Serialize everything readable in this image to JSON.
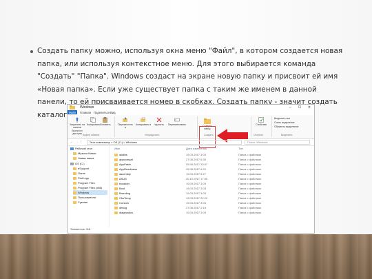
{
  "slide": {
    "text": "Создать папку можно, используя окна меню \"Файл\", в котором создается новая папка, или используя контекстное меню. Для этого выбирается команда \"Создать\" \"Папка\". Windows создаст на экране новую папку и присвоит ей имя «Новая папка». Если уже существует папка с таким же именем в данной панели, то ей присваивается номер в скобках. Создать папку - значит создать каталог."
  },
  "window": {
    "title": "Windows",
    "tabs": [
      "Файл",
      "Главная",
      "Поделиться",
      "Вид"
    ],
    "ribbon": {
      "pin": "Закрепить на панели быстрого доступа",
      "copy": "Копировать",
      "paste": "Вставить",
      "move": "Переместить в",
      "copy_to": "Копировать в",
      "delete": "Удалить",
      "rename": "Переименовать",
      "new_folder": "Создать папку",
      "properties": "Свойства",
      "select_all": "Выделить все",
      "select_none": "Снять выделение",
      "invert": "Обратить выделение",
      "groups": [
        "Буфер обмена",
        "Упорядочить",
        "Создать",
        "Открыть",
        "Выделить"
      ]
    },
    "address": "Этот компьютер > OS (C:) > Windows",
    "search_placeholder": "Поиск: Windows",
    "columns": [
      "Имя",
      "Дата изменения",
      "Тип"
    ],
    "nav": [
      "Рабочий стол",
      "Музыка Мамы",
      "Новая папка",
      "OS (C:)",
      "eSupport",
      "Game",
      "PerfLogs",
      "Program Files",
      "Program Files (x86)",
      "Windows",
      "Пользователи",
      "Сумлан"
    ],
    "files": [
      {
        "name": "addins",
        "date": "19.03.2017 3:03",
        "type": "Папка с файлами"
      },
      {
        "name": "appcompat",
        "date": "27.08.2017 6:30",
        "type": "Папка с файлами"
      },
      {
        "name": "AppPatch",
        "date": "25.08.2017 20:07",
        "type": "Папка с файлами"
      },
      {
        "name": "AppReadiness",
        "date": "25.08.2017 8:20",
        "type": "Папка с файлами"
      },
      {
        "name": "assembly",
        "date": "19.03.2017 6:27",
        "type": "Папка с файлами"
      },
      {
        "name": "ASUS",
        "date": "30.10.2017 17:55",
        "type": "Папка с файлами"
      },
      {
        "name": "bcastdvr",
        "date": "19.03.2017 3:03",
        "type": "Папка с файлами"
      },
      {
        "name": "Boot",
        "date": "19.03.2017 3:03",
        "type": "Папка с файлами"
      },
      {
        "name": "Branding",
        "date": "19.03.2017 3:03",
        "type": "Папка с файлами"
      },
      {
        "name": "CbsTemp",
        "date": "19.03.2017 22:22",
        "type": "Папка с файлами"
      },
      {
        "name": "Cursors",
        "date": "19.03.2017 3:03",
        "type": "Папка с файлами"
      },
      {
        "name": "debug",
        "date": "27.08.2017 2:18",
        "type": "Папка с файлами"
      },
      {
        "name": "diagnostics",
        "date": "19.03.2017 3:03",
        "type": "Папка с файлами"
      }
    ],
    "status": "Элементов: 118"
  },
  "colors": {
    "accent": "#1e6fc4",
    "highlight": "#e23c3c",
    "folder": "#f2c55c"
  }
}
